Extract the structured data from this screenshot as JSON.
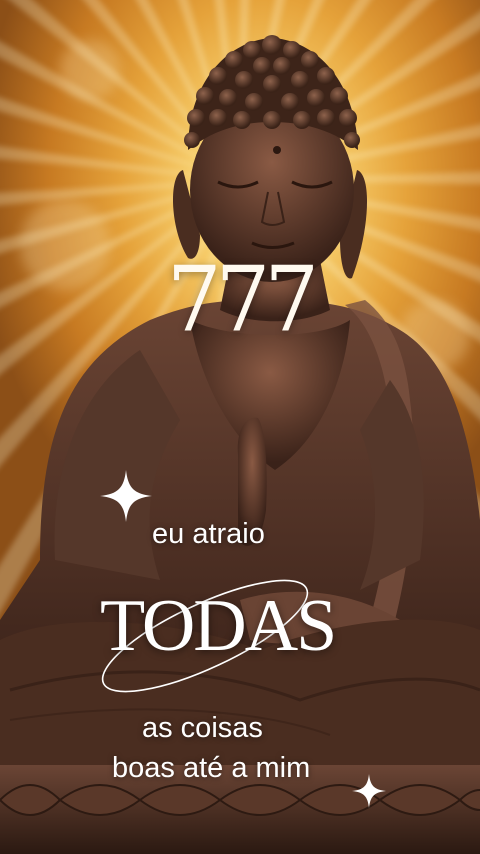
{
  "overlay": {
    "number": "777",
    "line1": "eu atraio",
    "line2": "TODAS",
    "line3": "as coisas",
    "line4": "boas até a mim"
  },
  "colors": {
    "text": "#ffffff",
    "background_gold": "#e5a23a",
    "statue_bronze": "#5b3a2a"
  },
  "icons": {
    "sparkle": "four-point-star"
  }
}
